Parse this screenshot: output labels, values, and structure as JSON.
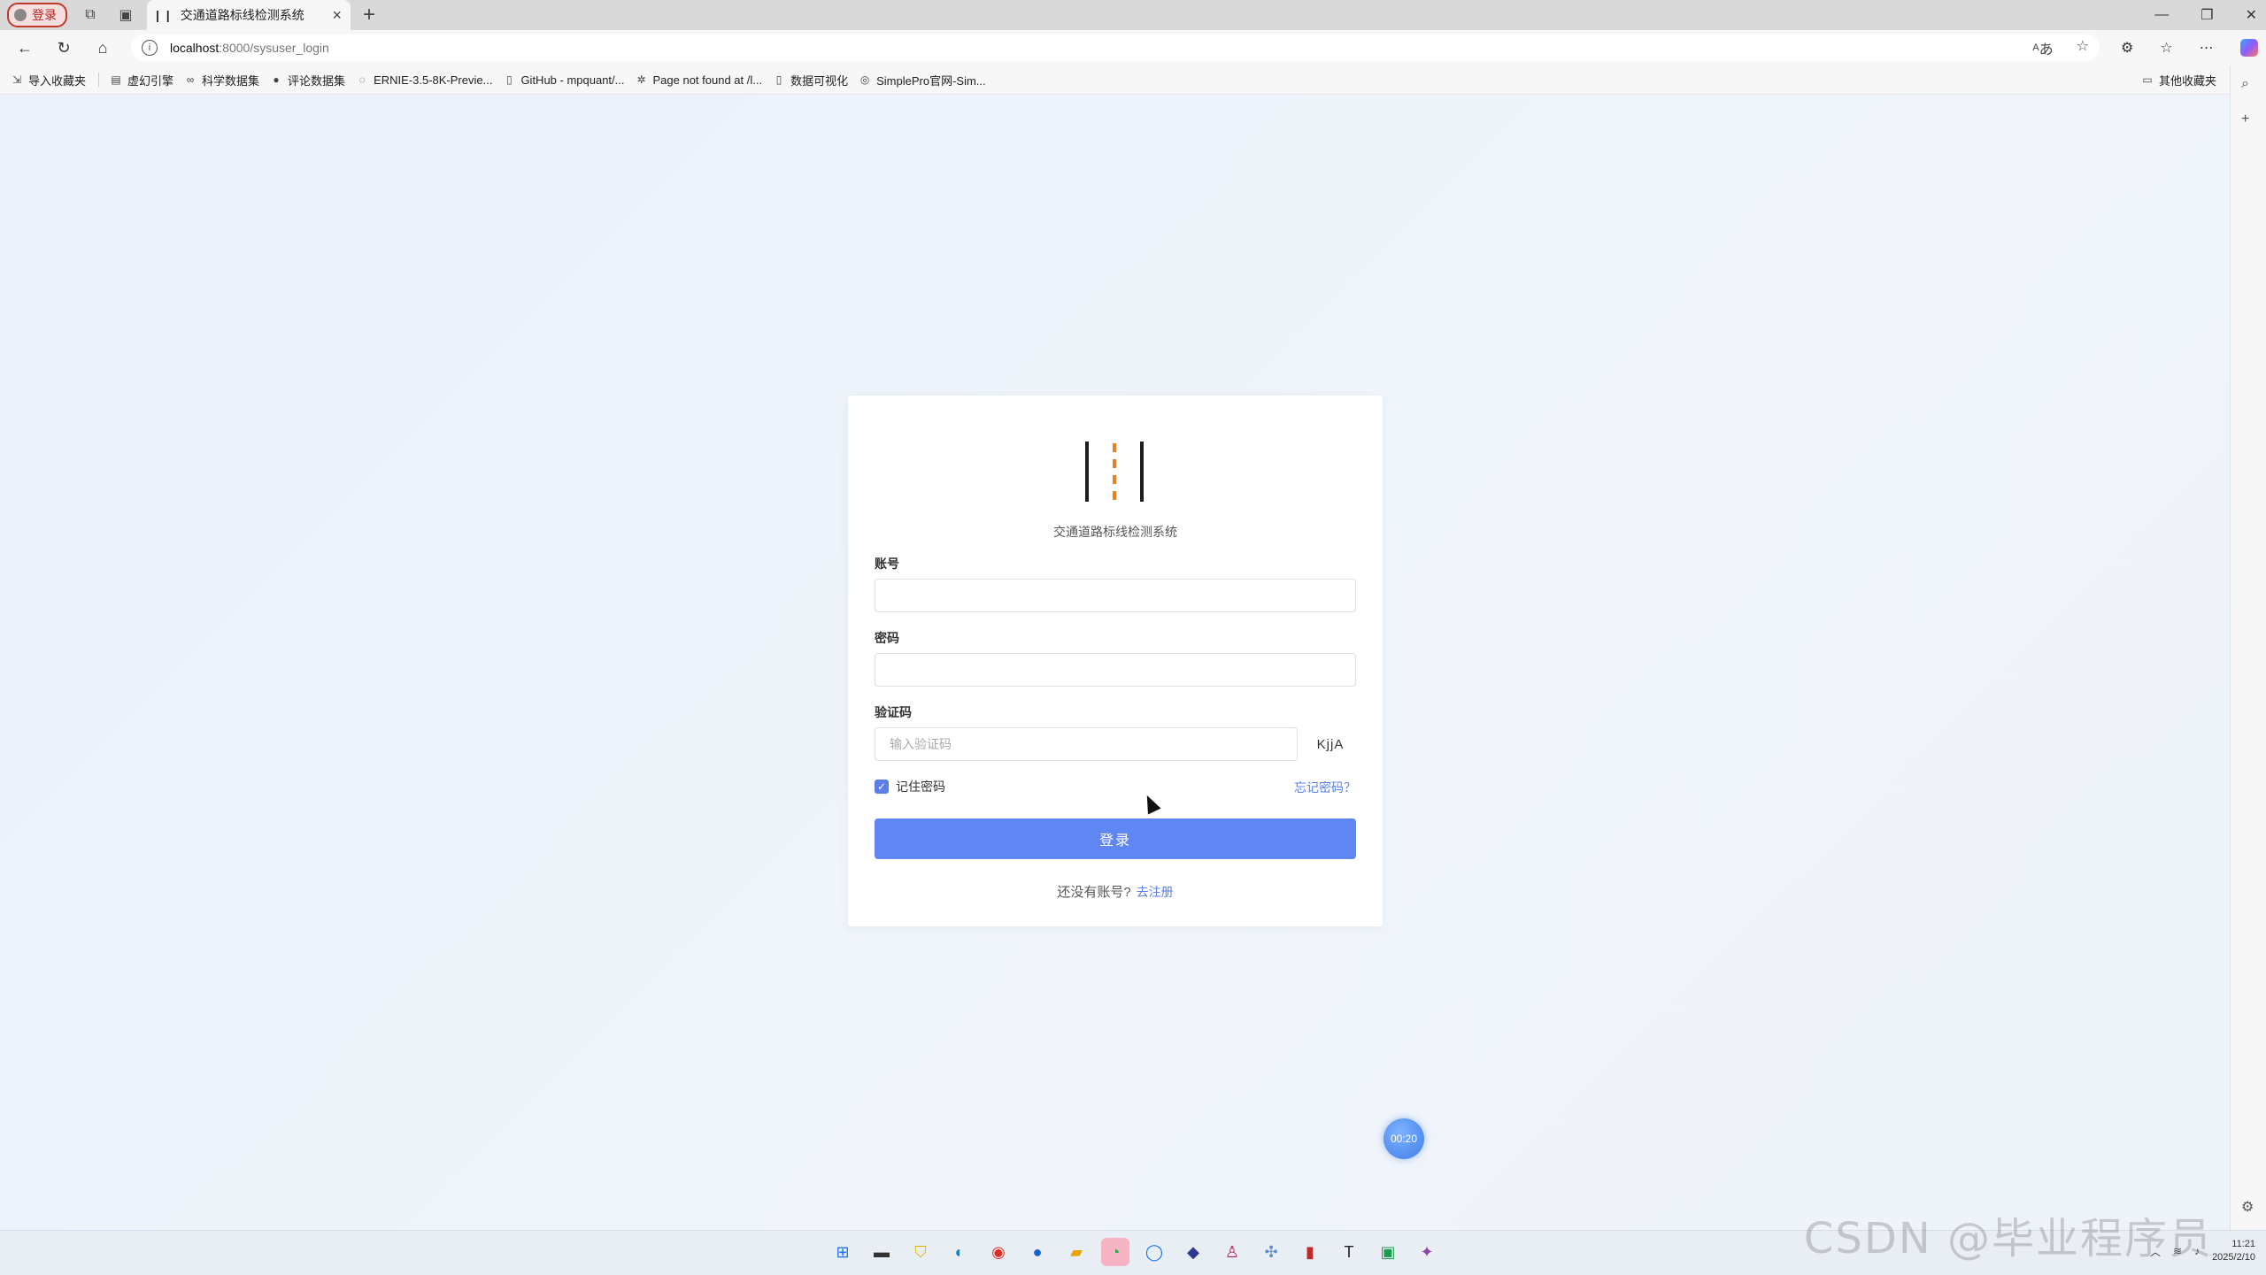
{
  "browser": {
    "profile_label": "登录",
    "tab": {
      "favicon": "| |",
      "title": "交通道路标线检测系统"
    },
    "url_host": "localhost",
    "url_path": ":8000/sysuser_login",
    "bookmarks": [
      {
        "icon": "import-icon",
        "label": "导入收藏夹"
      },
      {
        "icon": "page-icon",
        "label": "虚幻引擎"
      },
      {
        "icon": "link-icon",
        "label": "科学数据集"
      },
      {
        "icon": "github-icon",
        "label": "评论数据集"
      },
      {
        "icon": "ernie-icon",
        "label": "ERNIE-3.5-8K-Previe..."
      },
      {
        "icon": "page-icon",
        "label": "GitHub - mpquant/..."
      },
      {
        "icon": "paddle-icon",
        "label": "Page not found at /l..."
      },
      {
        "icon": "page-icon",
        "label": "数据可视化"
      },
      {
        "icon": "simplepro-icon",
        "label": "SimplePro官网-Sim..."
      }
    ],
    "other_bookmarks": "其他收藏夹"
  },
  "login": {
    "system_name": "交通道路标线检测系统",
    "account_label": "账号",
    "account_value": "",
    "password_label": "密码",
    "password_value": "",
    "captcha_label": "验证码",
    "captcha_placeholder": "输入验证码",
    "captcha_code": "KjjA",
    "remember_label": "记住密码",
    "remember_checked": true,
    "forgot_label": "忘记密码？",
    "submit_label": "登录",
    "register_prompt": "还没有账号?",
    "register_link": "去注册"
  },
  "overlay": {
    "timer": "00:20",
    "watermark": "CSDN @毕业程序员"
  },
  "taskbar": {
    "date": "2025/2/10",
    "time": "11:21"
  },
  "colors": {
    "primary": "#5f86f2",
    "link": "#5b7fe8",
    "logo_dash": "#e67e22"
  }
}
